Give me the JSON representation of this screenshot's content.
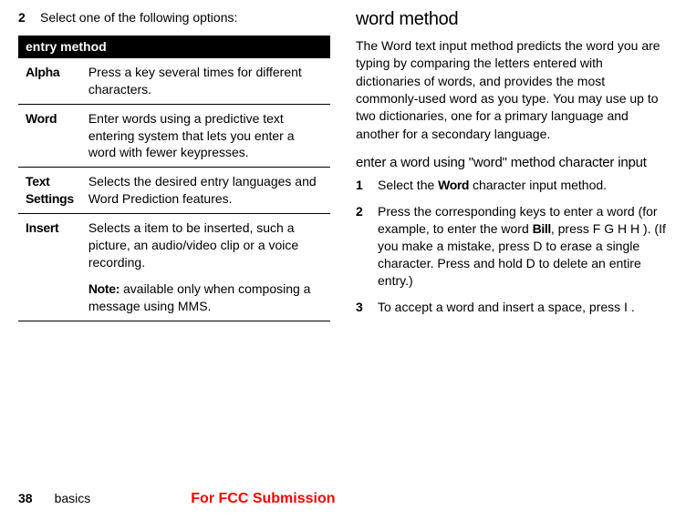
{
  "left": {
    "step2": {
      "num": "2",
      "text": "Select one of the following options:"
    },
    "table": {
      "header": "entry method",
      "rows": [
        {
          "name": "Alpha",
          "desc": "Press a key several times for different characters."
        },
        {
          "name": "Word",
          "desc": "Enter words using a predictive text entering system that lets you enter a word with fewer keypresses."
        },
        {
          "name": "Text Settings",
          "desc": "Selects the desired entry languages and Word Prediction features."
        },
        {
          "name": "Insert",
          "desc": "Selects a item to be inserted, such a picture, an audio/video clip or a voice recording.",
          "noteLabel": "Note:",
          "noteText": " available only when composing a message using MMS."
        }
      ]
    }
  },
  "right": {
    "heading": "word method",
    "intro": "The Word text input method predicts the word you are typing by comparing the letters entered with dictionaries of words, and provides the most commonly-used word as you type. You may use up to two dictionaries, one for a primary language and another for a secondary language.",
    "subheading": "enter a word using \"word\" method character input",
    "step1": {
      "num": "1",
      "pre": "Select the ",
      "bold": "Word",
      "post": " character input method."
    },
    "step2": {
      "num": "2",
      "t1": "Press the corresponding keys to enter a word (for example, to enter the word ",
      "bill": "Bill",
      "t2": ", press ",
      "keys": "F G H H",
      "t3": " ). (If you make a mistake, press ",
      "dkey1": "D",
      "t4": " to erase a single character. Press and hold ",
      "dkey2": "D",
      "t5": " to delete an entire entry.)"
    },
    "step3": {
      "num": "3",
      "t1": "To accept a word and insert a space, press ",
      "key": "I",
      "t2": " ."
    }
  },
  "footer": {
    "page": "38",
    "section": "basics",
    "fcc": "For FCC Submission"
  }
}
